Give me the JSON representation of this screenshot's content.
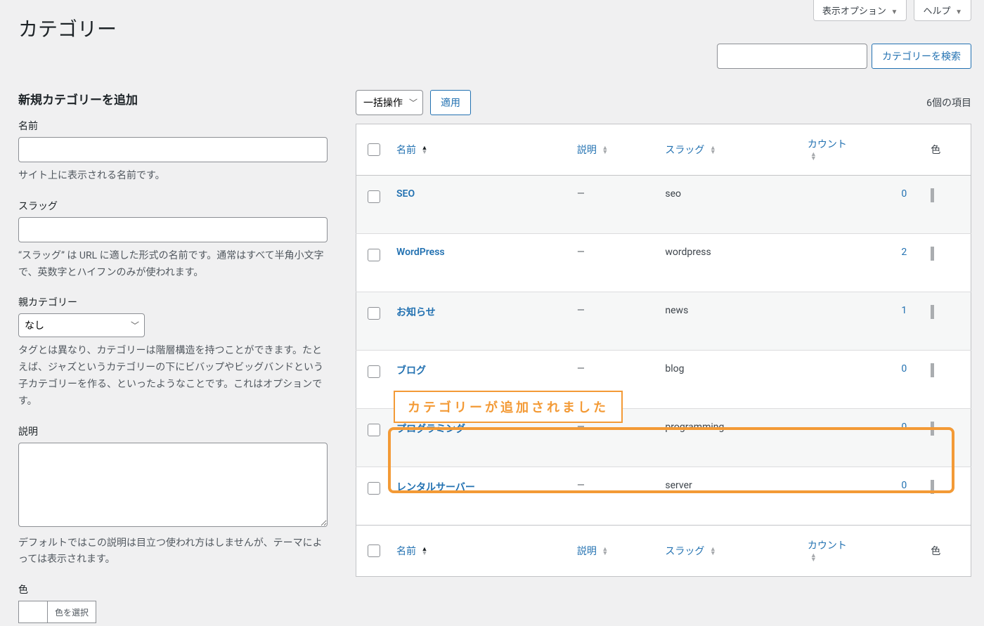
{
  "screen_options_label": "表示オプション",
  "help_label": "ヘルプ",
  "page_title": "カテゴリー",
  "search": {
    "placeholder": "",
    "button": "カテゴリーを検索"
  },
  "form": {
    "heading": "新規カテゴリーを追加",
    "name_label": "名前",
    "name_desc": "サイト上に表示される名前です。",
    "slug_label": "スラッグ",
    "slug_desc": "“スラッグ” は URL に適した形式の名前です。通常はすべて半角小文字で、英数字とハイフンのみが使われます。",
    "parent_label": "親カテゴリー",
    "parent_selected": "なし",
    "parent_desc": "タグとは異なり、カテゴリーは階層構造を持つことができます。たとえば、ジャズというカテゴリーの下にビバップやビッグバンドという子カテゴリーを作る、といったようなことです。これはオプションです。",
    "desc_label": "説明",
    "desc_desc": "デフォルトではこの説明は目立つ使われ方はしませんが、テーマによっては表示されます。",
    "color_label": "色",
    "color_button": "色を選択"
  },
  "bulk": {
    "label": "一括操作",
    "apply": "適用"
  },
  "count_text": "6個の項目",
  "columns": {
    "name": "名前",
    "desc": "説明",
    "slug": "スラッグ",
    "count": "カウント",
    "color": "色"
  },
  "rows": [
    {
      "name": "SEO",
      "desc": "—",
      "slug": "seo",
      "count": "0"
    },
    {
      "name": "WordPress",
      "desc": "—",
      "slug": "wordpress",
      "count": "2"
    },
    {
      "name": "お知らせ",
      "desc": "—",
      "slug": "news",
      "count": "1"
    },
    {
      "name": "ブログ",
      "desc": "—",
      "slug": "blog",
      "count": "0"
    },
    {
      "name": "プログラミング",
      "desc": "—",
      "slug": "programming",
      "count": "0"
    },
    {
      "name": "レンタルサーバー",
      "desc": "—",
      "slug": "server",
      "count": "0"
    }
  ],
  "callout_text": "カテゴリーが追加されました"
}
